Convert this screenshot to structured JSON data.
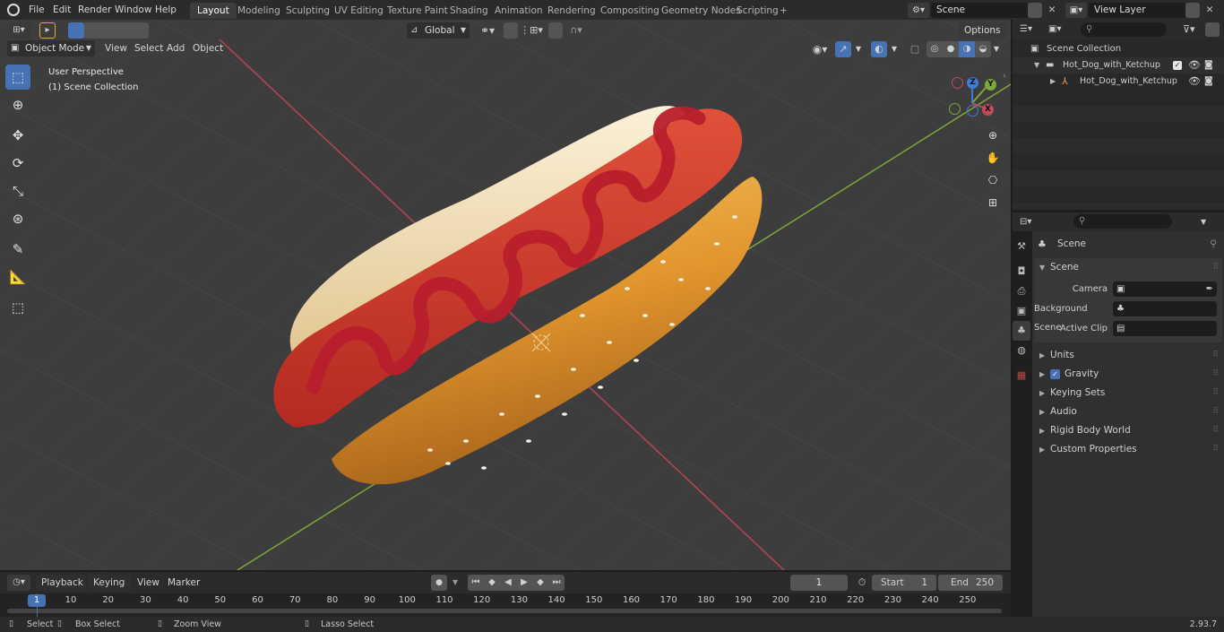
{
  "app": {
    "name": "Blender",
    "version": "2.93.7"
  },
  "topbar": {
    "menus": [
      "File",
      "Edit",
      "Render",
      "Window",
      "Help"
    ],
    "workspaces": [
      "Layout",
      "Modeling",
      "Sculpting",
      "UV Editing",
      "Texture Paint",
      "Shading",
      "Animation",
      "Rendering",
      "Compositing",
      "Geometry Nodes",
      "Scripting"
    ],
    "active_workspace": "Layout",
    "add_workspace": "+",
    "scene_name": "Scene",
    "view_layer": "View Layer"
  },
  "viewport_header": {
    "mode": "Object Mode",
    "menus": [
      "View",
      "Select",
      "Add",
      "Object"
    ],
    "orientation": "Global",
    "options_label": "Options"
  },
  "viewport": {
    "perspective_label": "User Perspective",
    "collection_label": "(1) Scene Collection",
    "gizmo": {
      "x": "X",
      "y": "Y",
      "z": "Z"
    },
    "colors": {
      "bg": "#3d3d3d",
      "x_axis": "#c24a5a",
      "y_axis": "#7ea83a"
    }
  },
  "toolbar": {
    "tools": [
      "select-box",
      "cursor",
      "move",
      "rotate",
      "scale",
      "transform",
      "annotate",
      "measure",
      "add-cube"
    ],
    "active": "select-box"
  },
  "outliner": {
    "root": "Scene Collection",
    "items": [
      {
        "name": "Hot_Dog_with_Ketchup",
        "level": 1,
        "type": "collection"
      },
      {
        "name": "Hot_Dog_with_Ketchup",
        "level": 2,
        "type": "object"
      }
    ]
  },
  "properties": {
    "context": "Scene",
    "panel": "Scene",
    "fields": [
      {
        "label": "Camera",
        "value": ""
      },
      {
        "label": "Background Scene",
        "value": ""
      },
      {
        "label": "Active Clip",
        "value": ""
      }
    ],
    "sections": [
      "Units",
      "Gravity",
      "Keying Sets",
      "Audio",
      "Rigid Body World",
      "Custom Properties"
    ],
    "gravity_checked": true
  },
  "timeline": {
    "menus": [
      "Playback",
      "Keying",
      "View",
      "Marker"
    ],
    "current_frame": "1",
    "start_label": "Start",
    "start": "1",
    "end_label": "End",
    "end": "250",
    "ticks": [
      "1",
      "10",
      "20",
      "30",
      "40",
      "50",
      "60",
      "70",
      "80",
      "90",
      "100",
      "110",
      "120",
      "130",
      "140",
      "150",
      "160",
      "170",
      "180",
      "190",
      "200",
      "210",
      "220",
      "230",
      "240",
      "250"
    ]
  },
  "statusbar": {
    "items": [
      "Select",
      "Box Select",
      "Zoom View",
      "Lasso Select"
    ],
    "version": "2.93.7"
  }
}
